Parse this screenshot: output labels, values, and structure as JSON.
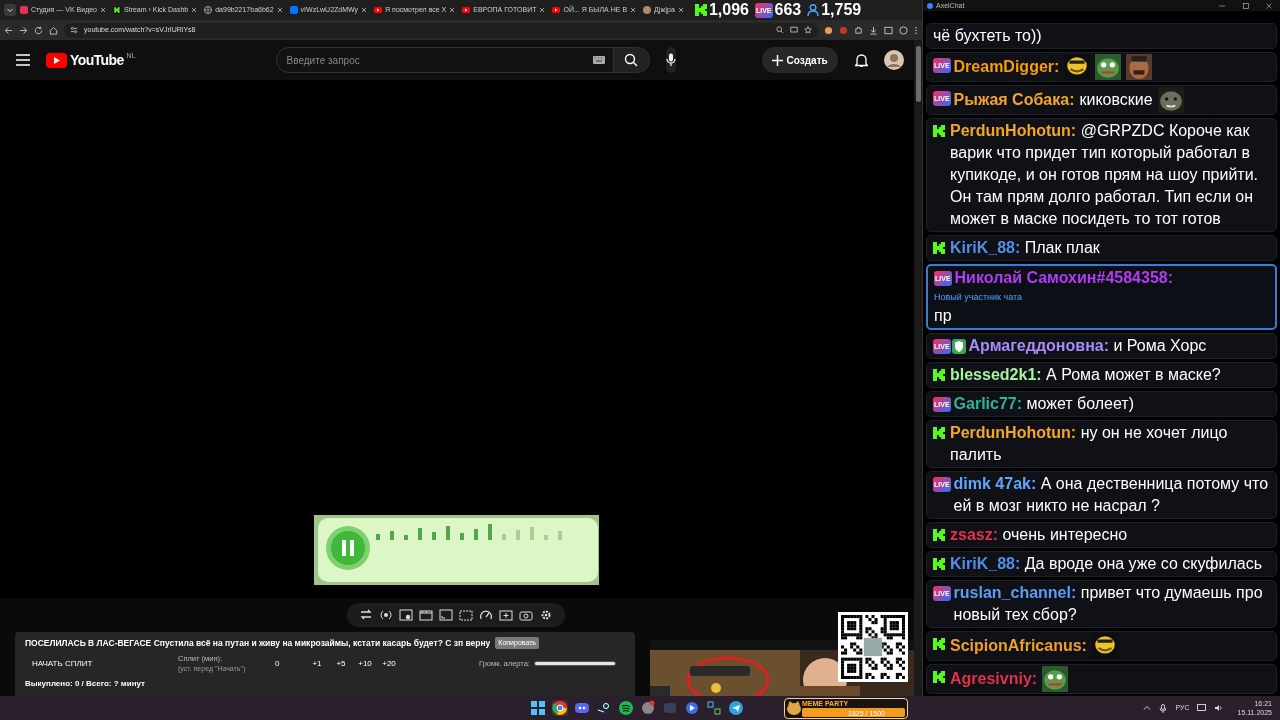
{
  "browser": {
    "tabs": [
      {
        "kind": "vkvideo",
        "title": "Студия — VK Видео"
      },
      {
        "kind": "kick",
        "title": "Stream › Kick Dashb"
      },
      {
        "kind": "globe",
        "title": "da99b2217ba6b62"
      },
      {
        "kind": "vk",
        "title": "vIWzLwU2ZdMWy"
      },
      {
        "kind": "youtube",
        "title": "Я посмотрел все Х"
      },
      {
        "kind": "youtube",
        "title": "ЕВРОПА ГОТОВИТ"
      },
      {
        "kind": "youtube",
        "title": "ОЙ... Я БЫЛА НЕ В"
      },
      {
        "kind": "avatar",
        "title": "Д|ж|ра"
      }
    ],
    "url": "youtube.com/watch?v=sVJrIURlYs8"
  },
  "stream_stats": [
    {
      "kind": "kick",
      "count": "1,096"
    },
    {
      "kind": "vk",
      "label": "LIVE",
      "count": "663"
    },
    {
      "kind": "viewers",
      "count": "1,759"
    }
  ],
  "youtube": {
    "logo": "YouTube",
    "region": "NL",
    "search_placeholder": "Введите запрос",
    "create_button": "Создать"
  },
  "panel": {
    "title": "ПОСЕЛИЛАСЬ В ЛАС-ВЕГАСЕ Спустила всё на путан и живу на микрозаймы, кстати касарь будет? С зп верну",
    "copy_button": "Копировать",
    "start_split": "НАЧАТЬ СПЛИТ",
    "split_label": "Сплит (мин):",
    "split_hint": "(уст. перед \"Начать\")",
    "split_value": "0",
    "increments": [
      "+1",
      "+5",
      "+10",
      "+20"
    ],
    "volume_label": "Громк. алерта:",
    "volume": {
      "level": 1
    },
    "summary": "Выкуплено: 0 / Всего: ? минут"
  },
  "chat": {
    "title": "AxelChat",
    "messages": [
      {
        "kind": "continuation",
        "text": "чё бухтеть то))"
      },
      {
        "kind": "vk",
        "platform_label": "LIVE",
        "author": "DreamDigger:",
        "color": "#f59e0b",
        "moderator": false,
        "highlighted": false
      },
      {
        "kind": "vk",
        "platform_label": "LIVE",
        "author": "Рыжая Собака:",
        "color": "#f5a524",
        "text": "киковские",
        "moderator": false,
        "highlighted": false
      },
      {
        "kind": "kick",
        "author": "PerdunHohotun:",
        "color": "#f5a623",
        "text": "@GRPZDC Короче как варик что придет тип который работал в купикоде, и он готов прям на шоу прийти. Он там прям долго работал. Тип если он может в маске посидеть то тот готов",
        "moderator": false,
        "highlighted": false
      },
      {
        "kind": "kick",
        "author": "KiriK_88:",
        "color": "#4f8fe8",
        "text": "Плак плак",
        "moderator": false,
        "highlighted": false
      },
      {
        "kind": "vk",
        "platform_label": "LIVE",
        "author": "Николай Самохин#4584358:",
        "color": "#b03cf0",
        "note": "Новый участник чата",
        "text": "пр",
        "moderator": false,
        "highlighted": true
      },
      {
        "kind": "vk",
        "platform_label": "LIVE",
        "author": "Армагеддоновна:",
        "color": "#a78bfa",
        "text": "и Рома Хорс",
        "moderator": true,
        "highlighted": false
      },
      {
        "kind": "kick",
        "author": "blessed2k1:",
        "color": "#a7f3a0",
        "text": "А Рома может в маске?",
        "moderator": false,
        "highlighted": false
      },
      {
        "kind": "vk",
        "platform_label": "LIVE",
        "author": "Garlic77:",
        "color": "#2db39a",
        "text": "может болеет)",
        "moderator": false,
        "highlighted": false
      },
      {
        "kind": "kick",
        "author": "PerdunHohotun:",
        "color": "#f5a623",
        "text": "ну он не хочет лицо палить",
        "moderator": false,
        "highlighted": false
      },
      {
        "kind": "vk",
        "platform_label": "LIVE",
        "author": "dimk 47ak:",
        "color": "#60a5fa",
        "text": "А она дественница потому что ей в мозг никто не насрал ?",
        "moderator": false,
        "highlighted": false
      },
      {
        "kind": "kick",
        "author": "zsasz:",
        "color": "#e0304a",
        "text": "очень интересно",
        "moderator": false,
        "highlighted": false
      },
      {
        "kind": "kick",
        "author": "KiriK_88:",
        "color": "#4f8fe8",
        "text": "Да вроде она уже со скуфилась",
        "moderator": false,
        "highlighted": false
      },
      {
        "kind": "vk",
        "platform_label": "LIVE",
        "author": "ruslan_channel:",
        "color": "#5b9cf5",
        "text": "привет что думаешь про новый тех сбор?",
        "moderator": false,
        "highlighted": false
      },
      {
        "kind": "kick",
        "author": "ScipionAfricanus:",
        "color": "#f0a020",
        "moderator": false,
        "highlighted": false
      },
      {
        "kind": "kick",
        "author": "Agresivniy:",
        "color": "#e0304a",
        "moderator": false,
        "highlighted": false
      }
    ]
  },
  "taskbar": {
    "meme_party": {
      "title": "MEME PARTY",
      "reading": "1825 / 1500",
      "level": 1
    },
    "language": "РУС",
    "time": "16:21",
    "date": "15.11.2025"
  }
}
